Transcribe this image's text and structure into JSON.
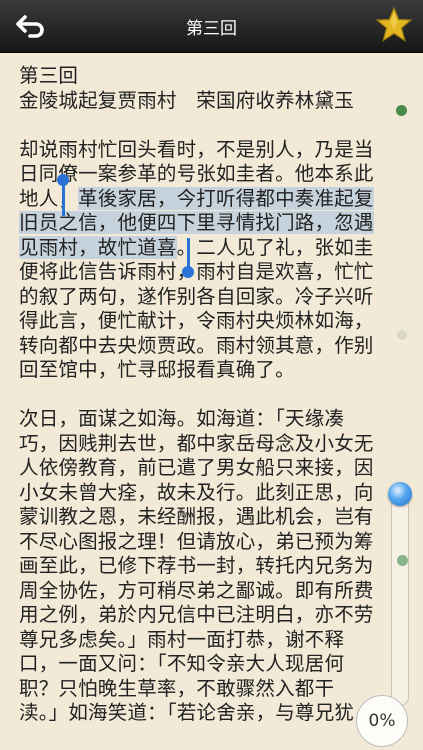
{
  "header": {
    "title": "第三回",
    "back_icon": "back-arrow-icon",
    "star_icon": "star-icon"
  },
  "chapter": {
    "number": "第三回",
    "title": "金陵城起复贾雨村　荣国府收养林黛玉"
  },
  "paragraph1": {
    "l1": "却说雨村忙回头看时，不是别人，乃是当",
    "l2": "日同僚一案参革的号张如圭者。他本系此",
    "l3a": "地人，",
    "l3b": "革後家居，今打听得都中奏准起复",
    "l4": "旧员之信，他便四下里寻情找门路，忽遇",
    "l5a": "见雨村，故忙道喜",
    "l5b": "。二人见了礼，张如圭",
    "l6": "便将此信告诉雨村，雨村自是欢喜，忙忙",
    "l7": "的叙了两句，遂作别各自回家。冷子兴听",
    "l8": "得此言，便忙献计，令雨村央烦林如海，",
    "l9": "转向都中去央烦贾政。雨村领其意，作别",
    "l10": "回至馆中，忙寻邸报看真确了。"
  },
  "paragraph2": {
    "l1": "次日，面谋之如海。如海道：「天缘凑",
    "l2": "巧，因贱荆去世，都中家岳母念及小女无",
    "l3": "人依傍教育，前已遣了男女船只来接，因",
    "l4": "小女未曾大痊，故未及行。此刻正思，向",
    "l5": "蒙训教之恩，未经酬报，遇此机会，岂有",
    "l6": "不尽心图报之理！但请放心，弟已预为筹",
    "l7": "画至此，已修下荐书一封，转托内兄务为",
    "l8": "周全协佐，方可稍尽弟之鄙诚。即有所费",
    "l9": "用之例，弟於内兄信中已注明白，亦不劳",
    "l10": "尊兄多虑矣。」雨村一面打恭，谢不释",
    "l11": "口，一面又问：「不知令亲大人现居何",
    "l12": "职？只怕晚生草率，不敢骤然入都干",
    "l13": "渎。」如海笑道：「若论舍亲，与尊兄犹"
  },
  "reading": {
    "progress_label": "0%",
    "progress": 0
  },
  "colors": {
    "background": "#f2ead7",
    "selection": "#c7d3dc",
    "handle": "#2a72d6",
    "star": "#e3b722"
  }
}
